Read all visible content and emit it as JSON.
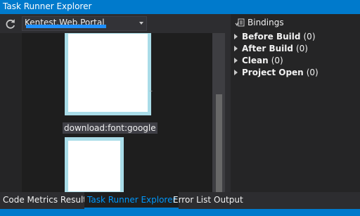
{
  "window": {
    "title": "Task Runner Explorer"
  },
  "toolbar": {
    "project_select": {
      "value": "Kentest.Web.Portal"
    }
  },
  "tasks": {
    "items": [
      {
        "label": "download:font:google"
      }
    ]
  },
  "bindings": {
    "title": "Bindings",
    "items": [
      {
        "label": "Before Build",
        "count": "(0)"
      },
      {
        "label": "After Build",
        "count": "(0)"
      },
      {
        "label": "Clean",
        "count": "(0)"
      },
      {
        "label": "Project Open",
        "count": "(0)"
      }
    ]
  },
  "bottom_tabs": {
    "items": [
      {
        "label": "Code Metrics Results"
      },
      {
        "label": "Task Runner Explorer"
      },
      {
        "label": "Error List"
      },
      {
        "label": "Output"
      }
    ],
    "active_index": 1
  },
  "colors": {
    "accent": "#007acc",
    "background": "#1e1e1e",
    "panel": "#252526",
    "active_tab_text": "#0097fb"
  },
  "icons": {
    "refresh": "refresh-icon",
    "bindings": "bindings-icon",
    "caret": "caret-right-icon",
    "dropdown": "chevron-down-icon"
  }
}
